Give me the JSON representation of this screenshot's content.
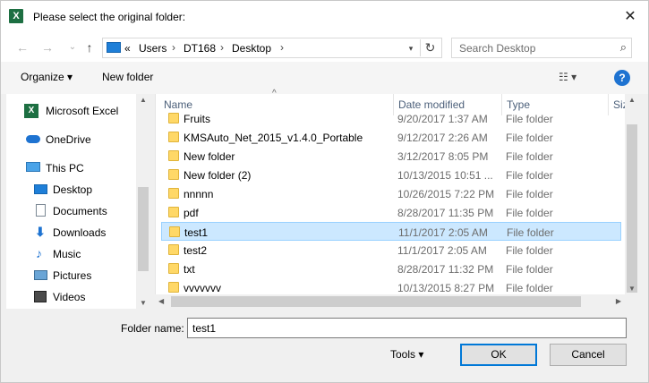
{
  "window": {
    "title": "Please select the original folder:",
    "app_icon": "excel-icon",
    "close": "✕"
  },
  "nav": {
    "back": "←",
    "forward": "→",
    "recent": "⌄",
    "up": "↑",
    "breadcrumb_prefix": "«",
    "crumbs": [
      "Users",
      "DT168",
      "Desktop"
    ],
    "crumb_sep": "›",
    "refresh": "↻",
    "search_placeholder": "Search Desktop",
    "search_icon": "⌕"
  },
  "toolbar": {
    "organize": "Organize ▾",
    "new_folder": "New folder",
    "view": "☷ ▾",
    "help": "?"
  },
  "sidebar": {
    "items": [
      {
        "label": "Microsoft Excel",
        "icon": "excel-icon"
      },
      {
        "label": "OneDrive",
        "icon": "cloud-icon"
      },
      {
        "label": "This PC",
        "icon": "computer-icon"
      },
      {
        "label": "Desktop",
        "icon": "desktop-icon"
      },
      {
        "label": "Documents",
        "icon": "document-icon"
      },
      {
        "label": "Downloads",
        "icon": "download-icon"
      },
      {
        "label": "Music",
        "icon": "music-icon"
      },
      {
        "label": "Pictures",
        "icon": "picture-icon"
      },
      {
        "label": "Videos",
        "icon": "video-icon"
      }
    ]
  },
  "columns": {
    "name": "Name",
    "date": "Date modified",
    "type": "Type",
    "size": "Size"
  },
  "files": [
    {
      "name": "Fruits",
      "date": "9/20/2017 1:37 AM",
      "type": "File folder"
    },
    {
      "name": "KMSAuto_Net_2015_v1.4.0_Portable",
      "date": "9/12/2017 2:26 AM",
      "type": "File folder"
    },
    {
      "name": "New folder",
      "date": "3/12/2017 8:05 PM",
      "type": "File folder"
    },
    {
      "name": "New folder (2)",
      "date": "10/13/2015 10:51 ...",
      "type": "File folder"
    },
    {
      "name": "nnnnn",
      "date": "10/26/2015 7:22 PM",
      "type": "File folder"
    },
    {
      "name": "pdf",
      "date": "8/28/2017 11:35 PM",
      "type": "File folder"
    },
    {
      "name": "test1",
      "date": "11/1/2017 2:05 AM",
      "type": "File folder",
      "selected": true
    },
    {
      "name": "test2",
      "date": "11/1/2017 2:05 AM",
      "type": "File folder"
    },
    {
      "name": "txt",
      "date": "8/28/2017 11:32 PM",
      "type": "File folder"
    },
    {
      "name": "vvvvvvv",
      "date": "10/13/2015 8:27 PM",
      "type": "File folder"
    }
  ],
  "footer": {
    "folder_label": "Folder name:",
    "folder_value": "test1",
    "tools": "Tools ▾",
    "ok": "OK",
    "cancel": "Cancel"
  }
}
